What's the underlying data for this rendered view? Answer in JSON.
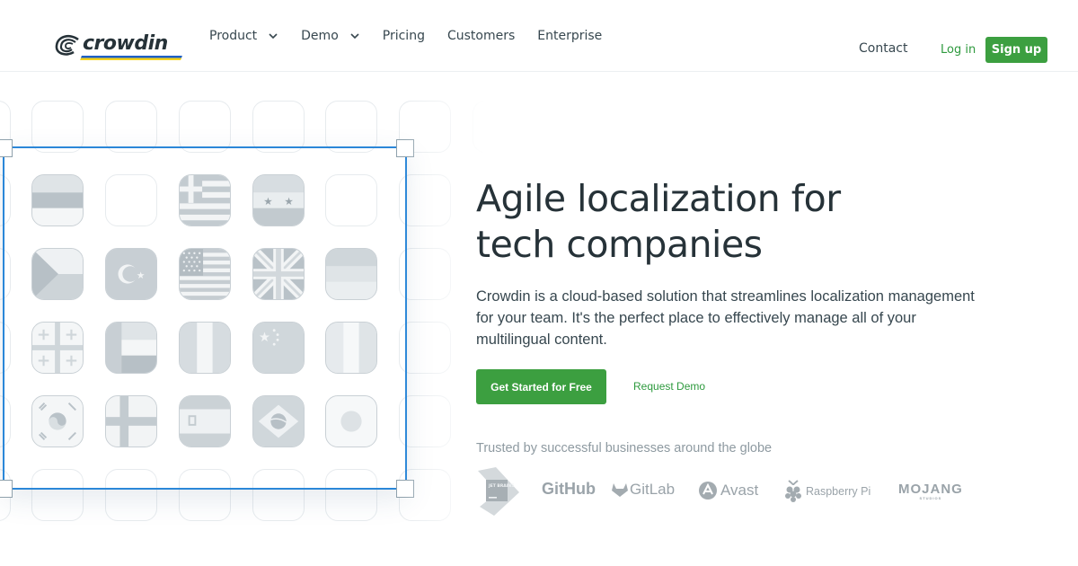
{
  "header": {
    "logo_text": "crowdin",
    "nav": [
      {
        "label": "Product",
        "has_dropdown": true
      },
      {
        "label": "Demo",
        "has_dropdown": true
      },
      {
        "label": "Pricing",
        "has_dropdown": false
      },
      {
        "label": "Customers",
        "has_dropdown": false
      },
      {
        "label": "Enterprise",
        "has_dropdown": false
      }
    ],
    "contact_label": "Contact",
    "login_label": "Log in",
    "signup_label": "Sign up"
  },
  "hero": {
    "title_line1": "Agile localization for",
    "title_line2": "tech companies",
    "description": "Crowdin is a cloud-based solution that streamlines localization management for your team. It's the perfect place to effectively manage all of your multilingual content.",
    "primary_cta": "Get Started for Free",
    "secondary_cta": "Request Demo",
    "trusted_text": "Trusted by successful businesses around the globe"
  },
  "logos": {
    "jetbrains": "JET BRAINS",
    "github": "GitHub",
    "gitlab": "GitLab",
    "avast": "Avast",
    "raspberry": "Raspberry Pi",
    "mojang": "MOJANG",
    "mojang_sub": "STUDIOS"
  },
  "flags": [
    "estonia-flag",
    "greece-flag",
    "syria-flag",
    "czech-flag",
    "turkey-flag",
    "usa-flag",
    "uk-flag",
    "lithuania-flag",
    "georgia-flag",
    "uae-flag",
    "italy-flag",
    "china-flag",
    "ireland-flag",
    "south-korea-flag",
    "finland-flag",
    "spain-flag",
    "brazil-flag",
    "japan-flag"
  ],
  "colors": {
    "accent_green": "#3c9f40",
    "link_green": "#2e9a3e",
    "selection_blue": "#2b87d8",
    "logo_blue": "#1f60c6",
    "logo_yellow": "#f5d21b",
    "text_dark": "#263238",
    "muted_gray": "#8e9aa1"
  }
}
